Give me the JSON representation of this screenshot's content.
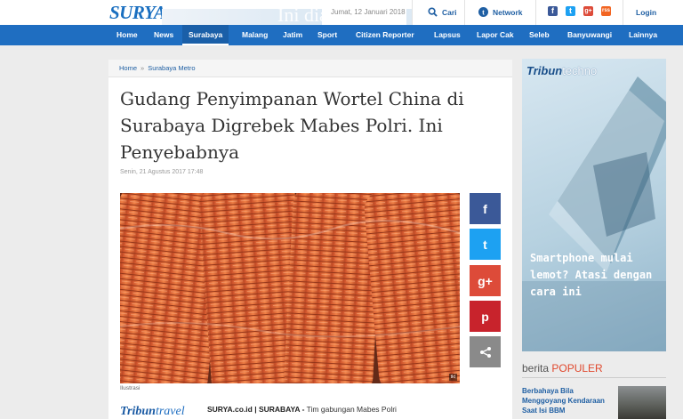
{
  "header": {
    "logo": "SURYA",
    "banner_text": "Ini dia...",
    "date": "Jumat, 12 Januari 2018",
    "search_label": "Cari",
    "network_label": "Network",
    "login_label": "Login",
    "social": [
      "f",
      "t",
      "g+",
      "rss"
    ]
  },
  "nav": {
    "items": [
      "Home",
      "News",
      "Surabaya",
      "Malang",
      "Jatim",
      "Sport",
      "Citizen Reporter",
      "Lapsus",
      "Lapor Cak",
      "Seleb",
      "Banyuwangi",
      "Lainnya"
    ],
    "active": "Surabaya"
  },
  "breadcrumb": {
    "home": "Home",
    "separator": "»",
    "section": "Surabaya Metro"
  },
  "article": {
    "title": "Gudang Penyimpanan Wortel China di Surabaya Digrebek Mabes Polri. Ini Penyebabnya",
    "date": "Senin, 21 Agustus 2017 17:48",
    "caption": "Ilustrasi",
    "photo_badge": "tkt",
    "lead_source": "SURYA.co.id | SURABAYA -",
    "lead_text": " Tim gabungan Mabes Polri",
    "promo_brand_1": "Tribun",
    "promo_brand_2": "travel"
  },
  "share": [
    {
      "icon": "facebook-icon",
      "glyph": "f",
      "color": "#3b5998"
    },
    {
      "icon": "twitter-icon",
      "glyph": "t",
      "color": "#1da1f2"
    },
    {
      "icon": "googleplus-icon",
      "glyph": "g+",
      "color": "#dd4b39"
    },
    {
      "icon": "pinterest-icon",
      "glyph": "p",
      "color": "#c8232c"
    },
    {
      "icon": "share-icon",
      "glyph": "<",
      "color": "#8a8a8a"
    }
  ],
  "sidebar": {
    "ad_brand_1": "Tribun",
    "ad_brand_2": "techno",
    "ad_text": "Smartphone mulai lemot? Atasi dengan cara ini",
    "populer_prefix": "berita ",
    "populer_highlight": "POPULER",
    "populer_item": "Berbahaya Bila Menggoyang Kendaraan Saat Isi BBM"
  }
}
